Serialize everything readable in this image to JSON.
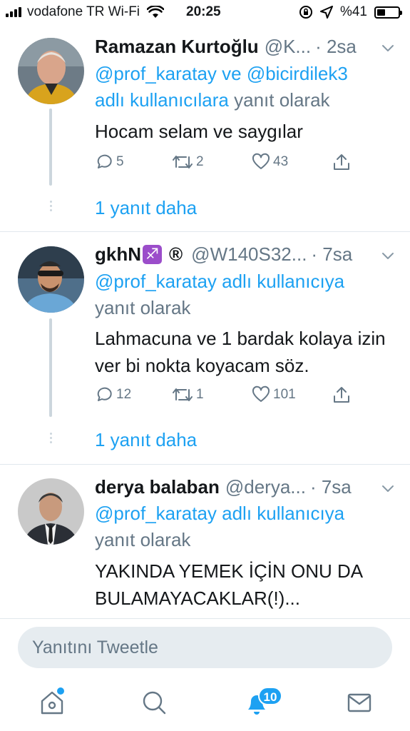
{
  "status_bar": {
    "carrier": "vodafone TR Wi-Fi",
    "time": "20:25",
    "battery": "%41",
    "battery_level": 0.41
  },
  "tweets": [
    {
      "name": "Ramazan Kurtoğlu",
      "handle": "@K...",
      "time": "· 2sa",
      "reply_prefix": "",
      "reply_mentions": "@prof_karatay ve @bicirdilek3",
      "reply_mid": "adlı kullanıcılara",
      "reply_suffix": "yanıt olarak",
      "text": "Hocam selam ve saygılar",
      "replies": "5",
      "retweets": "2",
      "likes": "43",
      "more_replies": "1 yanıt daha"
    },
    {
      "name": "gkhN",
      "emoji": "♐",
      "registered": "®",
      "handle": "@W140S32...",
      "time": "· 7sa",
      "reply_mentions": "@prof_karatay adlı kullanıcıya",
      "reply_suffix": "yanıt olarak",
      "text": "Lahmacuna ve 1 bardak kolaya izin ver bi nokta koyacam söz.",
      "replies": "12",
      "retweets": "1",
      "likes": "101",
      "more_replies": "1 yanıt daha"
    },
    {
      "name": "derya balaban",
      "handle": "@derya...",
      "time": "· 7sa",
      "reply_mentions": "@prof_karatay adlı kullanıcıya",
      "reply_suffix": "yanıt olarak",
      "text": "YAKINDA YEMEK İÇİN ONU DA BULAMAYACAKLAR(!)..."
    }
  ],
  "composer": {
    "placeholder": "Yanıtını Tweetle"
  },
  "tab_bar": {
    "notifications_badge": "10",
    "icons": [
      "home-icon",
      "search-icon",
      "notifications-icon",
      "messages-icon"
    ]
  },
  "colors": {
    "accent": "#1da1f2",
    "secondary_text": "#657786",
    "thread_line": "#ccd6dd"
  }
}
